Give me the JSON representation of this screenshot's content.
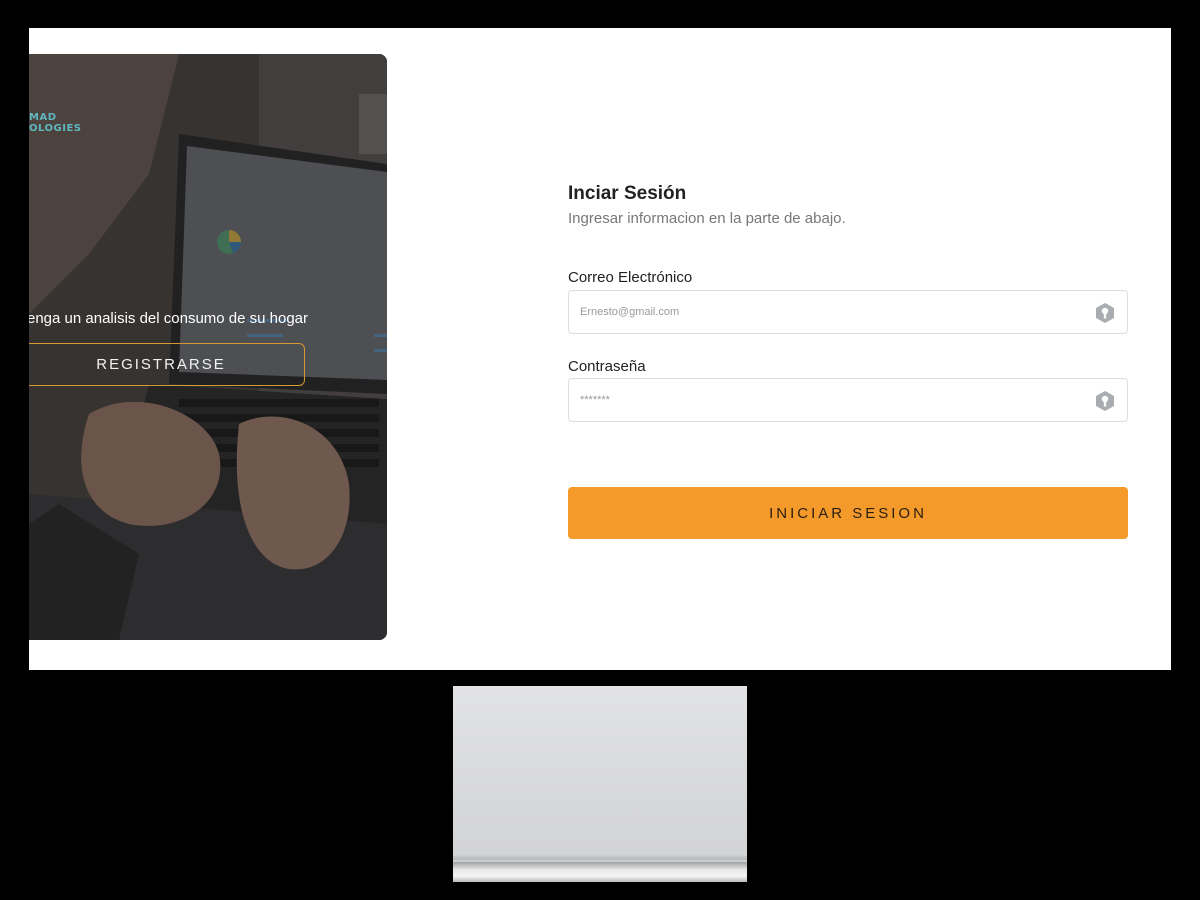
{
  "hero": {
    "logo_line1": "MAD",
    "logo_line2": "OLOGIES",
    "tagline": "enga un analisis del consumo de su hogar",
    "register_label": "REGISTRARSE"
  },
  "login": {
    "title": "Inciar Sesión",
    "subtitle": "Ingresar informacion en la parte de abajo.",
    "email_label": "Correo Electrónico",
    "email_placeholder": "Ernesto@gmail.com",
    "password_label": "Contraseña",
    "password_placeholder": "*******",
    "submit_label": "INICIAR SESION",
    "field_icon": "key-icon"
  },
  "colors": {
    "accent": "#f39a2a",
    "register_border": "#d79a33",
    "logo": "#5fb7c0"
  }
}
